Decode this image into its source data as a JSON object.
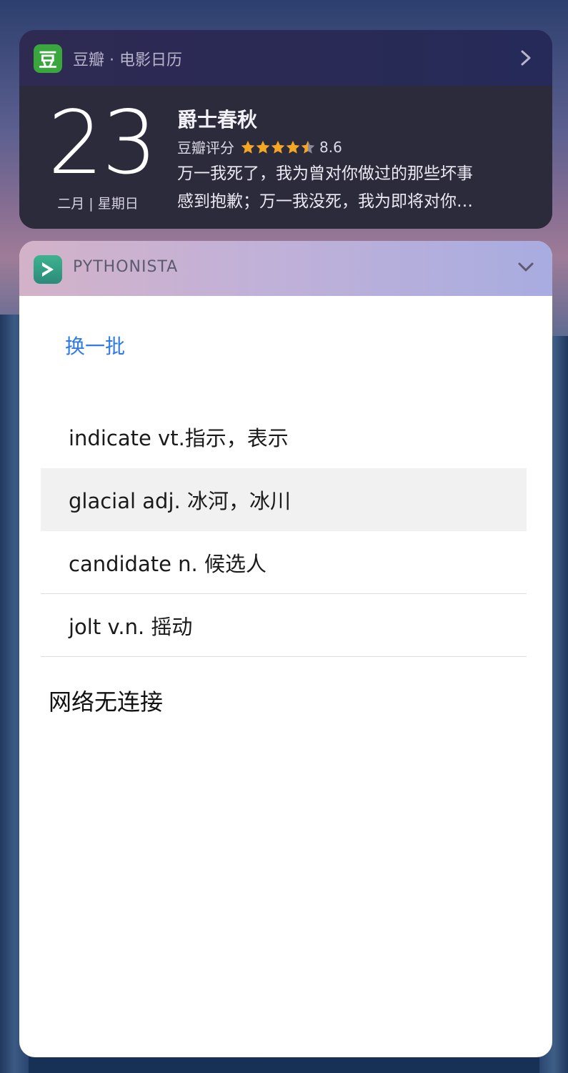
{
  "douban": {
    "app_name": "豆瓣 · 电影日历",
    "icon_glyph": "豆",
    "icon_color": "#3aa63e",
    "day": "23",
    "date_sub": "二月 | 星期日",
    "movie_title": "爵士春秋",
    "rating_label": "豆瓣评分",
    "rating_stars": 4.5,
    "rating_value": "8.6",
    "quote_line1": "万一我死了，我为曾对你做过的那些坏事",
    "quote_line2": "感到抱歉；万一我没死，我为即将对你…"
  },
  "pythonista": {
    "app_name": "PYTHONISTA",
    "refresh_label": "换一批",
    "words": [
      "indicate vt.指示，表示",
      "glacial adj. 冰河，冰川",
      "candidate n. 候选人",
      "jolt v.n. 摇动"
    ],
    "status": "网络无连接",
    "accent": "#2f7ae5"
  }
}
